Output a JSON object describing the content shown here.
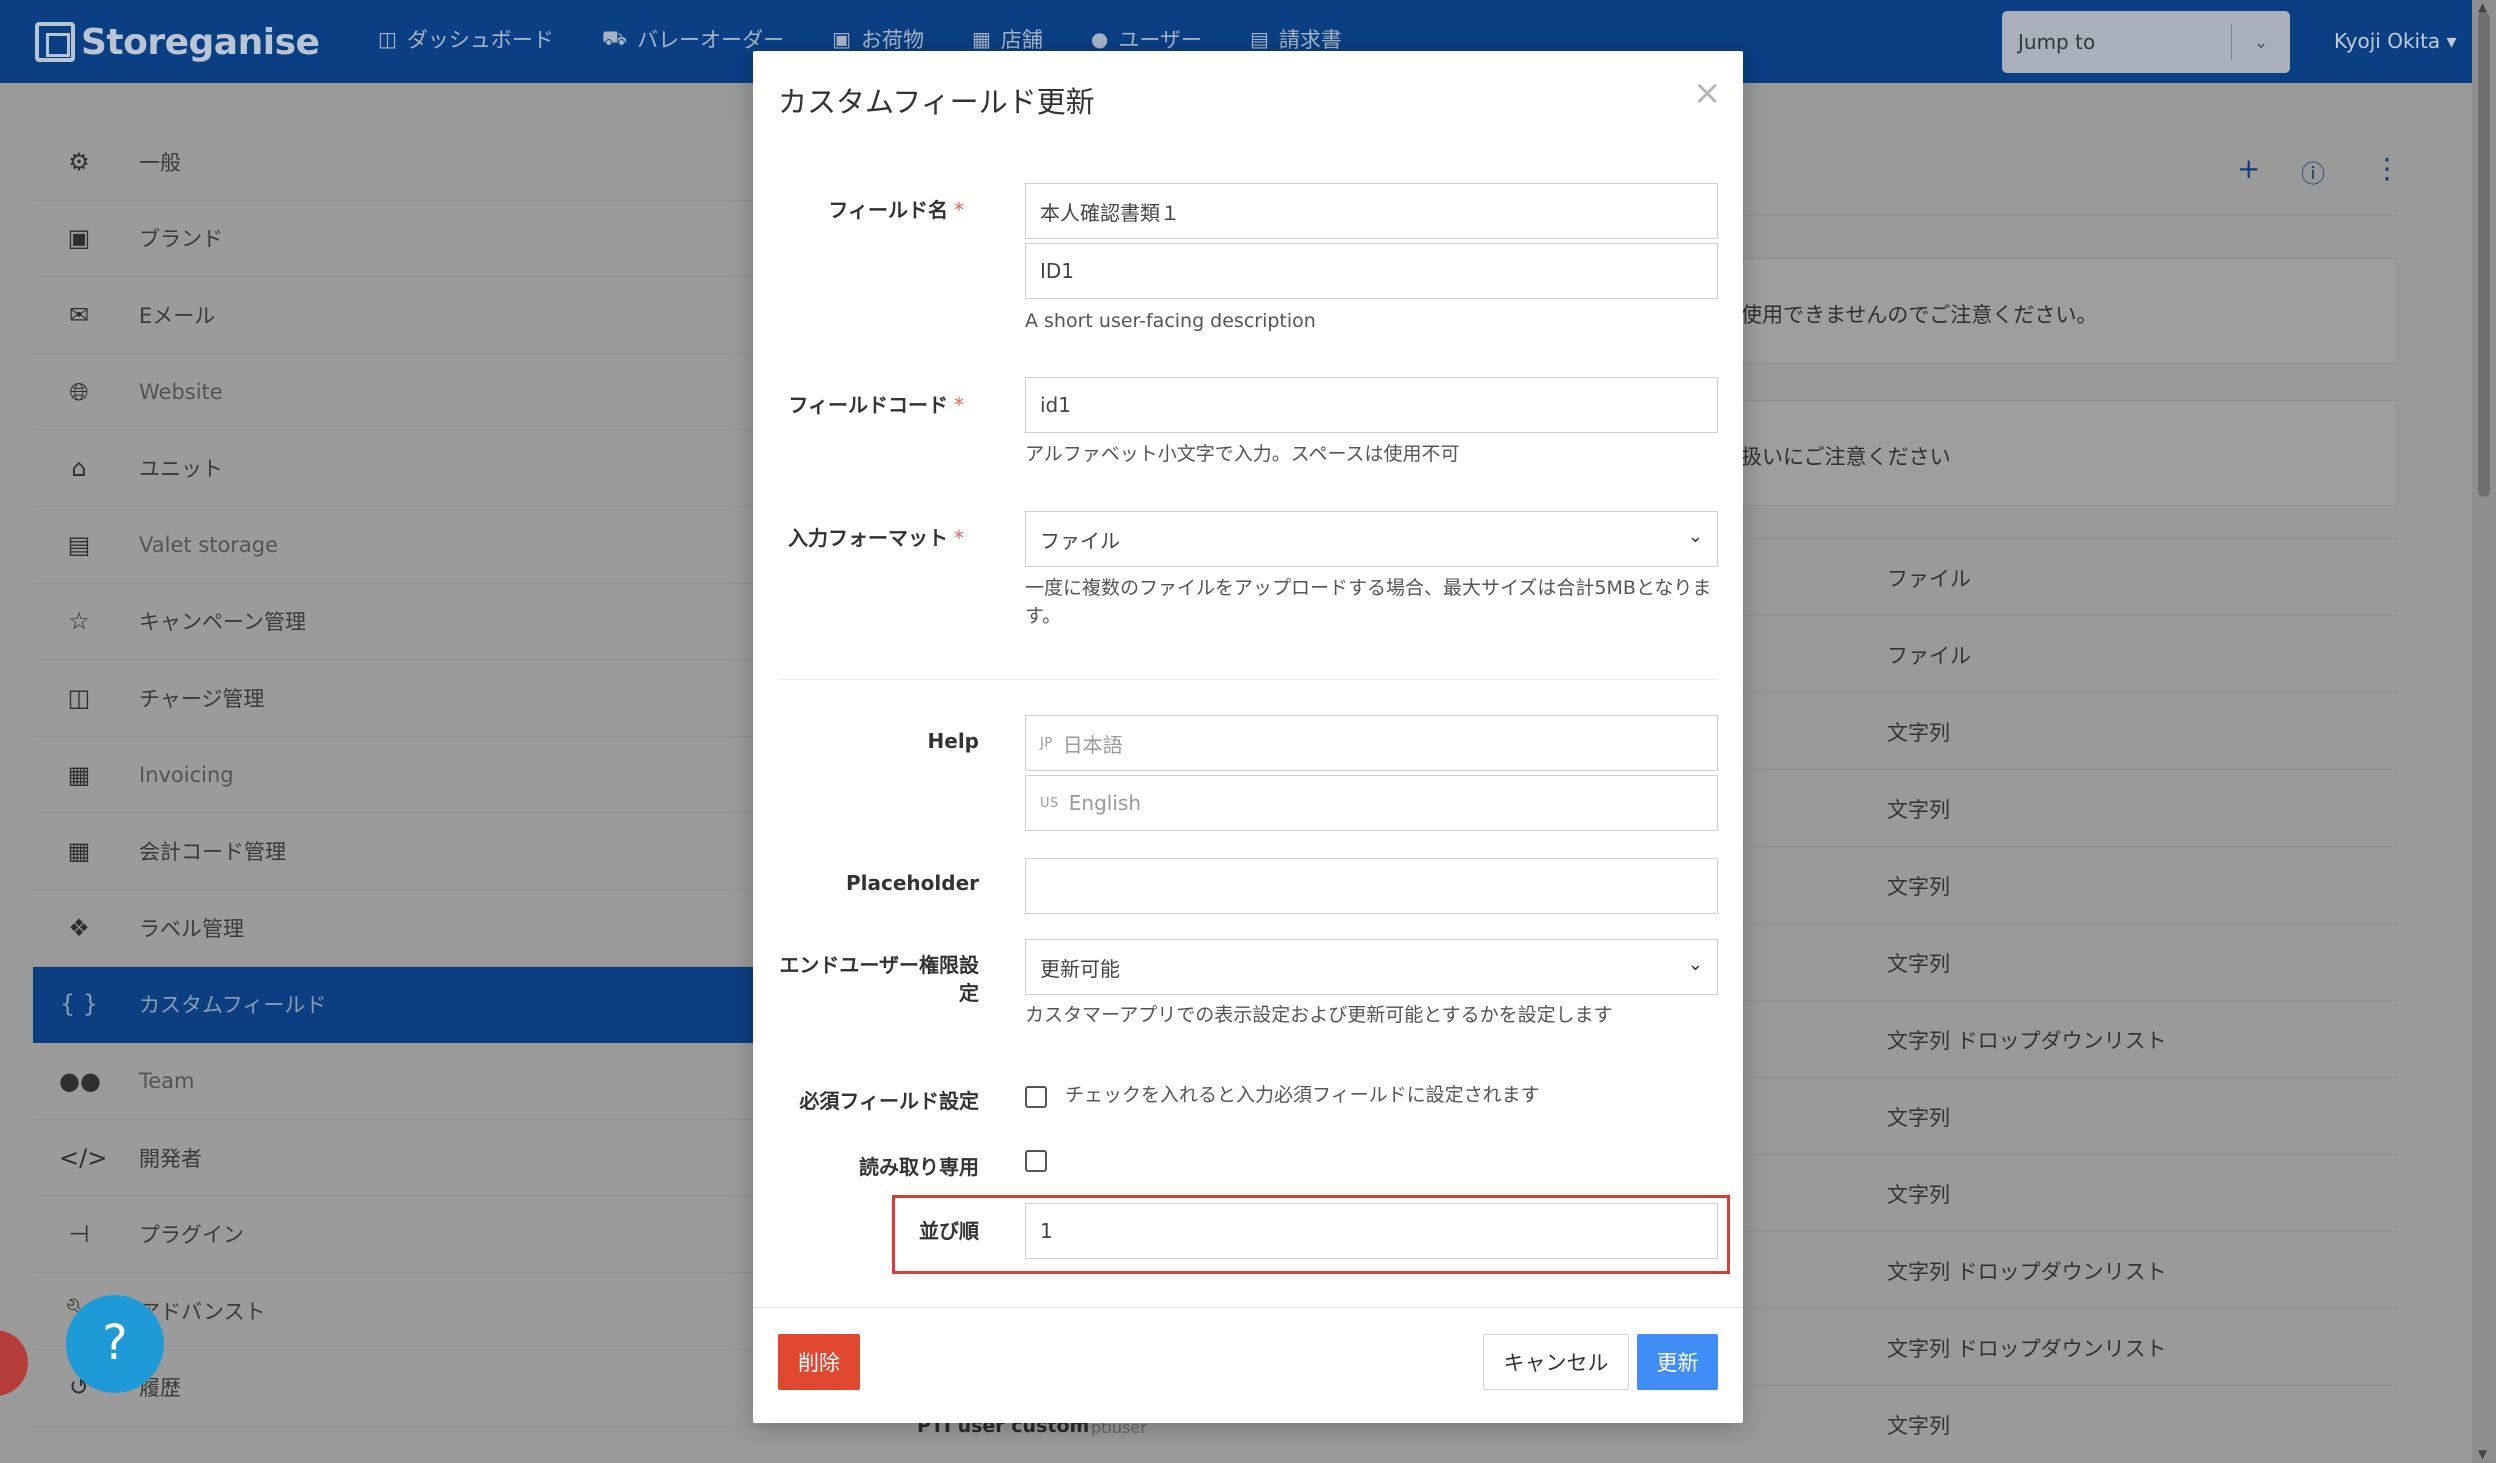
{
  "app": {
    "brand": "Storeganise"
  },
  "nav": {
    "items": [
      {
        "label": "ダッシュボード",
        "icon": "sitemap-icon"
      },
      {
        "label": "バレーオーダー",
        "icon": "truck-icon"
      },
      {
        "label": "お荷物",
        "icon": "box-icon"
      },
      {
        "label": "店舗",
        "icon": "building-icon"
      },
      {
        "label": "ユーザー",
        "icon": "user-icon"
      },
      {
        "label": "請求書",
        "icon": "invoice-icon"
      }
    ],
    "jump_to": "Jump to",
    "user": "Kyoji Okita"
  },
  "sidebar": {
    "items": [
      {
        "label": "一般",
        "icon": "gear-icon"
      },
      {
        "label": "ブランド",
        "icon": "image-icon"
      },
      {
        "label": "Eメール",
        "icon": "envelope-icon"
      },
      {
        "label": "Website",
        "icon": "globe-icon"
      },
      {
        "label": "ユニット",
        "icon": "warehouse-icon"
      },
      {
        "label": "Valet storage",
        "icon": "archive-icon"
      },
      {
        "label": "キャンペーン管理",
        "icon": "star-icon"
      },
      {
        "label": "チャージ管理",
        "icon": "money-icon"
      },
      {
        "label": "Invoicing",
        "icon": "document-dollar-icon"
      },
      {
        "label": "会計コード管理",
        "icon": "calculator-icon"
      },
      {
        "label": "ラベル管理",
        "icon": "tags-icon"
      },
      {
        "label": "カスタムフィールド",
        "icon": "braces-icon"
      },
      {
        "label": "Team",
        "icon": "users-icon"
      },
      {
        "label": "開発者",
        "icon": "code-icon"
      },
      {
        "label": "プラグイン",
        "icon": "plug-icon"
      },
      {
        "label": "アドバンスト",
        "icon": "wrench-icon"
      },
      {
        "label": "履歴",
        "icon": "history-icon"
      }
    ]
  },
  "background": {
    "notice1": "使用できませんのでご注意ください。",
    "notice2": "扱いにご注意ください",
    "formats": [
      "ファイル",
      "ファイル",
      "文字列",
      "文字列",
      "文字列",
      "文字列",
      "文字列 ドロップダウンリスト",
      "文字列",
      "文字列",
      "文字列 ドロップダウンリスト",
      "文字列 ドロップダウンリスト",
      "文字列"
    ],
    "last_row": {
      "name": "PTI user custom",
      "code": "ptiuser"
    }
  },
  "modal": {
    "title": "カスタムフィールド更新",
    "close": "×",
    "field_name": {
      "label": "フィールド名",
      "value_jp": "本人確認書類１",
      "value_en": "ID1",
      "hint": "A short user-facing description"
    },
    "field_code": {
      "label": "フィールドコード",
      "value": "id1",
      "hint": "アルファベット小文字で入力。スペースは使用不可"
    },
    "input_format": {
      "label": "入力フォーマット",
      "value": "ファイル",
      "hint": "一度に複数のファイルをアップロードする場合、最大サイズは合計5MBとなります。"
    },
    "help": {
      "label": "Help",
      "jp_flag": "JP",
      "jp_placeholder": "日本語",
      "us_flag": "US",
      "us_placeholder": "English"
    },
    "placeholder": {
      "label": "Placeholder",
      "value": ""
    },
    "end_user_permission": {
      "label_line1": "エンドユーザー権限設",
      "label_line2": "定",
      "value": "更新可能",
      "hint": "カスタマーアプリでの表示設定および更新可能とするかを設定します"
    },
    "required": {
      "label": "必須フィールド設定",
      "checkbox_label": "チェックを入れると入力必須フィールドに設定されます"
    },
    "readonly": {
      "label": "読み取り専用"
    },
    "sort_order": {
      "label": "並び順",
      "value": "1"
    },
    "buttons": {
      "delete": "削除",
      "cancel": "キャンセル",
      "update": "更新"
    },
    "highlight_color": "#d93a3a"
  },
  "help_bubble": "?"
}
